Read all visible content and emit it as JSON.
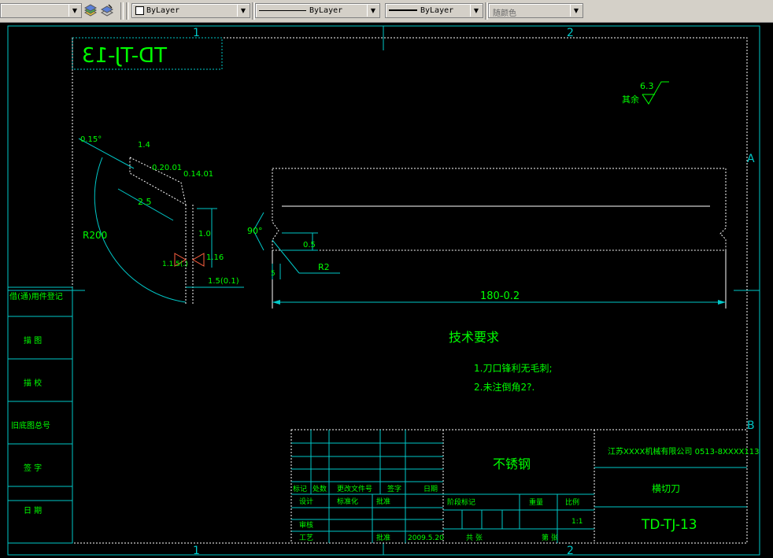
{
  "toolbar": {
    "color_combo": "ByLayer",
    "linetype_combo": "ByLayer",
    "lineweight_combo": "ByLayer",
    "plotstyle_combo": "随颜色"
  },
  "drawing": {
    "border_col_labels": [
      "1",
      "2"
    ],
    "border_row_labels": [
      "A",
      "B"
    ],
    "mirrored_code": "TD-TJ-13",
    "roughness_label": "其余",
    "roughness_value": "6.3",
    "dims": {
      "ang_top": "0.15°",
      "d1": "1.4",
      "d2": "0.20.01",
      "d3": "0.14.01",
      "d4": "2.5",
      "radius": "R200",
      "h1": "1.0",
      "h2": "1.16",
      "h3": "1.5(0.1)",
      "sym_left": "1.1.5(.)",
      "angle90": "90°",
      "w1": "0.5",
      "r2": "R2",
      "w2": "5",
      "length": "180-0.2"
    },
    "tech_title": "技术要求",
    "tech_notes": [
      "1.刀口锋利无毛刺;",
      "2.未注倒角2?."
    ]
  },
  "left_strip": [
    "借(通)用件登记",
    "描  图",
    "描  校",
    "旧底图总号",
    "签  字",
    "日  期"
  ],
  "title_block": {
    "material": "不锈钢",
    "company": "江苏XXXX机械有限公司 0513-8XXXX113",
    "part_name": "横切刀",
    "drawing_no": "TD-TJ-13",
    "row_headers": [
      "标记",
      "处数",
      "更改文件号",
      "签字",
      "日期"
    ],
    "sign_rows": [
      "设计",
      "审核",
      "工艺"
    ],
    "std_check": "标准化",
    "approve": "批准",
    "date": "2009.5.20",
    "stage_mark": "阶段标记",
    "weight": "重量",
    "scale_label": "比例",
    "scale": "1:1",
    "sheet_total": "共  张",
    "sheet_no": "第  张"
  }
}
